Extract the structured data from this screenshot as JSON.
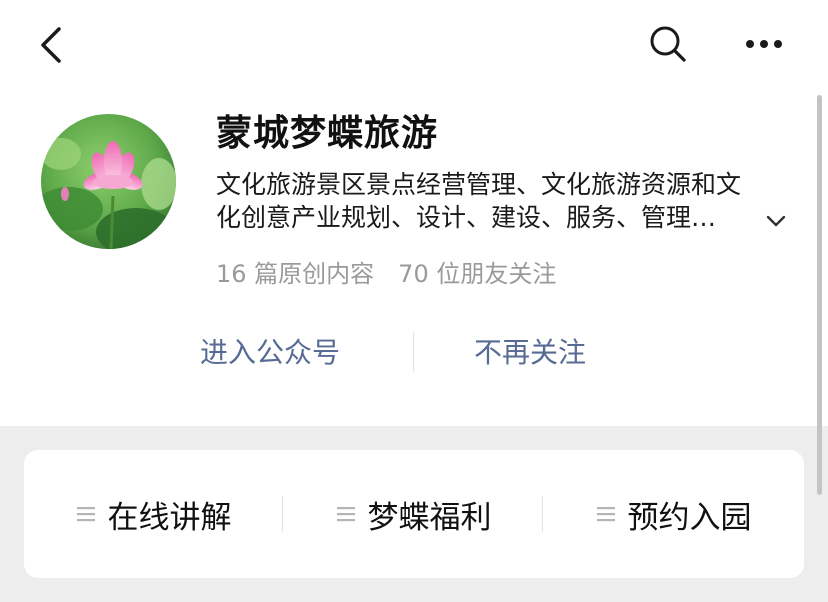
{
  "nav": {
    "back_icon": "chevron-left-icon",
    "search_icon": "search-icon",
    "more_icon": "more-horizontal-icon"
  },
  "profile": {
    "name": "蒙城梦蝶旅游",
    "description_line1": "文化旅游景区景点经营管理、文化旅游资源和文",
    "description_line2": "化创意产业规划、设计、建设、服务、管理…",
    "expand_icon": "chevron-down-icon",
    "stats": {
      "articles": "16 篇原创内容",
      "followers": "70 位朋友关注"
    },
    "avatar": "lotus-flower-avatar"
  },
  "actions": {
    "enter_label": "进入公众号",
    "unfollow_label": "不再关注"
  },
  "menu": {
    "items": [
      {
        "label": "在线讲解",
        "icon": "menu-list-icon"
      },
      {
        "label": "梦蝶福利",
        "icon": "menu-list-icon"
      },
      {
        "label": "预约入园",
        "icon": "menu-list-icon"
      }
    ]
  },
  "colors": {
    "link": "#576b95",
    "secondary_text": "#9a9a9a",
    "gray_background": "#ededed"
  }
}
